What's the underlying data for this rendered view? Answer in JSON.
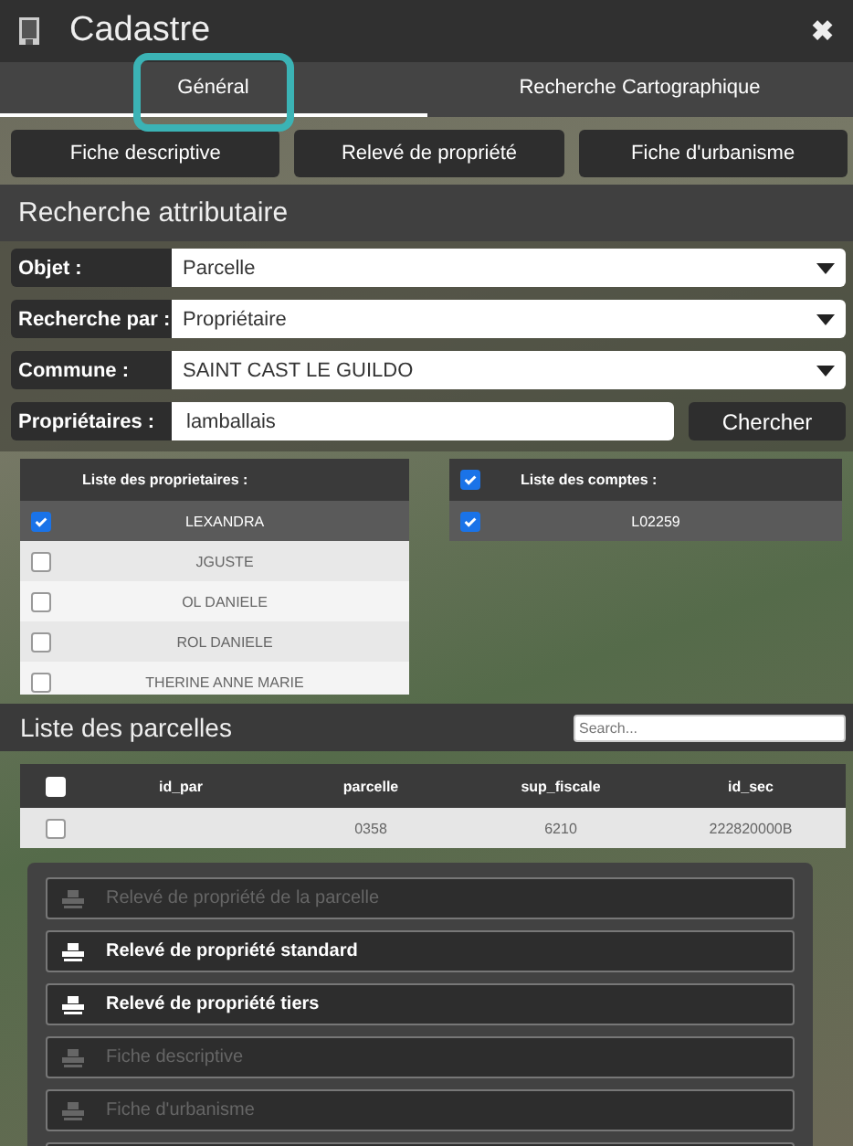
{
  "window": {
    "title": "Cadastre",
    "close": "✖"
  },
  "tabs": [
    {
      "label": "Général",
      "selected": true
    },
    {
      "label": "Recherche Cartographique",
      "selected": false
    }
  ],
  "report_buttons": [
    "Fiche descriptive",
    "Relevé de propriété",
    "Fiche d'urbanisme"
  ],
  "attribute_search": {
    "title": "Recherche attributaire",
    "fields": [
      {
        "kind": "select",
        "label": "Objet :",
        "value": "Parcelle"
      },
      {
        "kind": "select",
        "label": "Recherche par :",
        "value": "Propriétaire"
      },
      {
        "kind": "select",
        "label": "Commune :",
        "value": "SAINT CAST LE GUILDO"
      },
      {
        "kind": "text",
        "label": "Propriétaires :",
        "value": "lamballais",
        "button": "Chercher"
      }
    ]
  },
  "owners_list": {
    "title": "Liste des proprietaires :",
    "rows": [
      {
        "name": "LEXANDRA",
        "checked": true
      },
      {
        "name": "JGUSTE",
        "checked": false
      },
      {
        "name": "OL DANIELE",
        "checked": false
      },
      {
        "name": "ROL DANIELE",
        "checked": false
      },
      {
        "name": "THERINE ANNE MARIE",
        "checked": false
      }
    ]
  },
  "accounts_list": {
    "title": "Liste des comptes :",
    "all_checked": true,
    "rows": [
      {
        "name": "L02259",
        "checked": true
      }
    ]
  },
  "parcels": {
    "title": "Liste des parcelles",
    "search_placeholder": "Search...",
    "all_checked": false,
    "columns": [
      "id_par",
      "parcelle",
      "sup_fiscale",
      "id_sec"
    ],
    "rows": [
      {
        "checked": false,
        "cells": [
          "",
          "0358",
          "6210",
          "222820000B"
        ]
      }
    ]
  },
  "actions": [
    {
      "label": "Relevé de propriété de la parcelle",
      "disabled": true
    },
    {
      "label": "Relevé de propriété standard",
      "disabled": false
    },
    {
      "label": "Relevé de propriété tiers",
      "disabled": false
    },
    {
      "label": "Fiche descriptive",
      "disabled": true
    },
    {
      "label": "Fiche d'urbanisme",
      "disabled": true
    }
  ]
}
